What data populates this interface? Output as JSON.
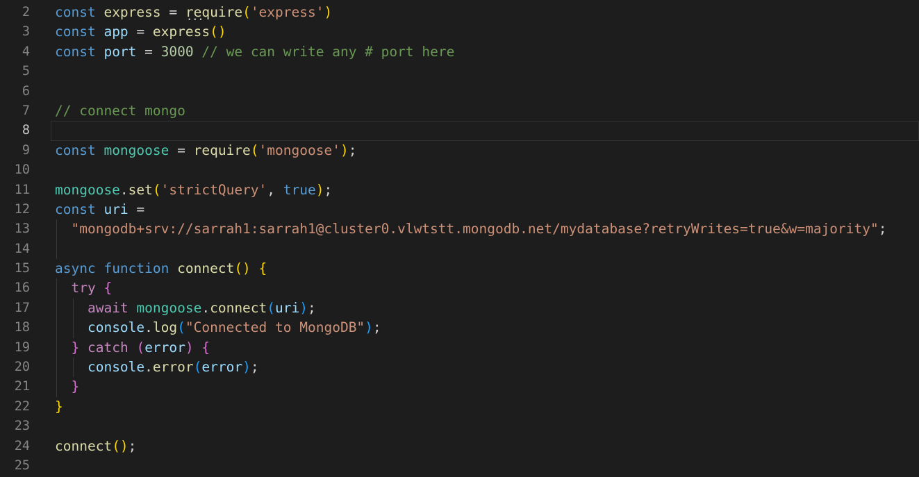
{
  "editor": {
    "background": "#1d1d1d",
    "line_number_color": "#858585",
    "active_line_number_color": "#c6c6c6",
    "active_line_border_color": "#313131",
    "indent_guide_color": "#373737",
    "token_colors": {
      "k": "#569CD6",
      "c": "#C586C0",
      "v": "#9CDCFE",
      "t": "#4EC9B0",
      "f": "#DCDCAA",
      "h": "#DCDCAA",
      "s": "#CE9178",
      "n": "#B5CEA8",
      "m": "#6A9955",
      "p": "#D4D4D4",
      "g": "#FFD700",
      "o": "#DA70D6",
      "u": "#179FFF"
    },
    "lines": [
      {
        "n": "2",
        "active": false,
        "guides": [],
        "tokens": [
          [
            "k",
            "const"
          ],
          [
            "p",
            " "
          ],
          [
            "f",
            "express"
          ],
          [
            "p",
            " = "
          ],
          [
            "h",
            "require"
          ],
          [
            "g",
            "("
          ],
          [
            "s",
            "'express'"
          ],
          [
            "g",
            ")"
          ]
        ]
      },
      {
        "n": "3",
        "active": false,
        "guides": [],
        "tokens": [
          [
            "k",
            "const"
          ],
          [
            "p",
            " "
          ],
          [
            "v",
            "app"
          ],
          [
            "p",
            " = "
          ],
          [
            "f",
            "express"
          ],
          [
            "g",
            "()"
          ]
        ]
      },
      {
        "n": "4",
        "active": false,
        "guides": [],
        "tokens": [
          [
            "k",
            "const"
          ],
          [
            "p",
            " "
          ],
          [
            "v",
            "port"
          ],
          [
            "p",
            " = "
          ],
          [
            "n",
            "3000"
          ],
          [
            "p",
            " "
          ],
          [
            "m",
            "// we can write any # port here"
          ]
        ]
      },
      {
        "n": "5",
        "active": false,
        "guides": [],
        "tokens": []
      },
      {
        "n": "6",
        "active": false,
        "guides": [],
        "tokens": []
      },
      {
        "n": "7",
        "active": false,
        "guides": [],
        "tokens": [
          [
            "m",
            "// connect mongo"
          ]
        ]
      },
      {
        "n": "8",
        "active": true,
        "guides": [],
        "tokens": []
      },
      {
        "n": "9",
        "active": false,
        "guides": [],
        "tokens": [
          [
            "k",
            "const"
          ],
          [
            "p",
            " "
          ],
          [
            "t",
            "mongoose"
          ],
          [
            "p",
            " = "
          ],
          [
            "f",
            "require"
          ],
          [
            "g",
            "("
          ],
          [
            "s",
            "'mongoose'"
          ],
          [
            "g",
            ")"
          ],
          [
            "p",
            ";"
          ]
        ]
      },
      {
        "n": "10",
        "active": false,
        "guides": [],
        "tokens": []
      },
      {
        "n": "11",
        "active": false,
        "guides": [],
        "tokens": [
          [
            "t",
            "mongoose"
          ],
          [
            "p",
            "."
          ],
          [
            "f",
            "set"
          ],
          [
            "g",
            "("
          ],
          [
            "s",
            "'strictQuery'"
          ],
          [
            "p",
            ", "
          ],
          [
            "k",
            "true"
          ],
          [
            "g",
            ")"
          ],
          [
            "p",
            ";"
          ]
        ]
      },
      {
        "n": "12",
        "active": false,
        "guides": [],
        "tokens": [
          [
            "k",
            "const"
          ],
          [
            "p",
            " "
          ],
          [
            "v",
            "uri"
          ],
          [
            "p",
            " ="
          ]
        ]
      },
      {
        "n": "13",
        "active": false,
        "guides": [
          0
        ],
        "tokens": [
          [
            "p",
            "  "
          ],
          [
            "s",
            "\"mongodb+srv://sarrah1:sarrah1@cluster0.vlwtstt.mongodb.net/mydatabase?retryWrites=true&w=majority\""
          ],
          [
            "p",
            ";"
          ]
        ]
      },
      {
        "n": "14",
        "active": false,
        "guides": [
          0
        ],
        "tokens": []
      },
      {
        "n": "15",
        "active": false,
        "guides": [],
        "tokens": [
          [
            "k",
            "async"
          ],
          [
            "p",
            " "
          ],
          [
            "k",
            "function"
          ],
          [
            "p",
            " "
          ],
          [
            "f",
            "connect"
          ],
          [
            "g",
            "()"
          ],
          [
            "p",
            " "
          ],
          [
            "g",
            "{"
          ]
        ]
      },
      {
        "n": "16",
        "active": false,
        "guides": [
          0
        ],
        "tokens": [
          [
            "p",
            "  "
          ],
          [
            "c",
            "try"
          ],
          [
            "p",
            " "
          ],
          [
            "o",
            "{"
          ]
        ]
      },
      {
        "n": "17",
        "active": false,
        "guides": [
          0,
          1
        ],
        "tokens": [
          [
            "p",
            "    "
          ],
          [
            "c",
            "await"
          ],
          [
            "p",
            " "
          ],
          [
            "t",
            "mongoose"
          ],
          [
            "p",
            "."
          ],
          [
            "f",
            "connect"
          ],
          [
            "u",
            "("
          ],
          [
            "v",
            "uri"
          ],
          [
            "u",
            ")"
          ],
          [
            "p",
            ";"
          ]
        ]
      },
      {
        "n": "18",
        "active": false,
        "guides": [
          0,
          1
        ],
        "tokens": [
          [
            "p",
            "    "
          ],
          [
            "v",
            "console"
          ],
          [
            "p",
            "."
          ],
          [
            "f",
            "log"
          ],
          [
            "u",
            "("
          ],
          [
            "s",
            "\"Connected to MongoDB\""
          ],
          [
            "u",
            ")"
          ],
          [
            "p",
            ";"
          ]
        ]
      },
      {
        "n": "19",
        "active": false,
        "guides": [
          0
        ],
        "tokens": [
          [
            "p",
            "  "
          ],
          [
            "o",
            "}"
          ],
          [
            "p",
            " "
          ],
          [
            "c",
            "catch"
          ],
          [
            "p",
            " "
          ],
          [
            "o",
            "("
          ],
          [
            "v",
            "error"
          ],
          [
            "o",
            ")"
          ],
          [
            "p",
            " "
          ],
          [
            "o",
            "{"
          ]
        ]
      },
      {
        "n": "20",
        "active": false,
        "guides": [
          0,
          1
        ],
        "tokens": [
          [
            "p",
            "    "
          ],
          [
            "v",
            "console"
          ],
          [
            "p",
            "."
          ],
          [
            "f",
            "error"
          ],
          [
            "u",
            "("
          ],
          [
            "v",
            "error"
          ],
          [
            "u",
            ")"
          ],
          [
            "p",
            ";"
          ]
        ]
      },
      {
        "n": "21",
        "active": false,
        "guides": [
          0
        ],
        "tokens": [
          [
            "p",
            "  "
          ],
          [
            "o",
            "}"
          ]
        ]
      },
      {
        "n": "22",
        "active": false,
        "guides": [],
        "tokens": [
          [
            "g",
            "}"
          ]
        ]
      },
      {
        "n": "23",
        "active": false,
        "guides": [],
        "tokens": []
      },
      {
        "n": "24",
        "active": false,
        "guides": [],
        "tokens": [
          [
            "f",
            "connect"
          ],
          [
            "g",
            "()"
          ],
          [
            "p",
            ";"
          ]
        ]
      },
      {
        "n": "25",
        "active": false,
        "guides": [],
        "tokens": []
      }
    ]
  }
}
